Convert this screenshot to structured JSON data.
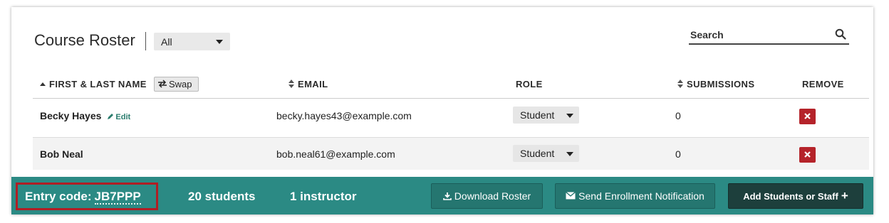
{
  "header": {
    "title": "Course Roster",
    "filter_value": "All",
    "search_placeholder": "Search"
  },
  "table": {
    "columns": {
      "name": "FIRST & LAST NAME",
      "swap": "Swap",
      "email": "EMAIL",
      "role": "ROLE",
      "submissions": "SUBMISSIONS",
      "remove": "REMOVE"
    },
    "rows": [
      {
        "name": "Becky Hayes",
        "edit": "Edit",
        "email": "becky.hayes43@example.com",
        "role": "Student",
        "submissions": "0"
      },
      {
        "name": "Bob Neal",
        "email": "bob.neal61@example.com",
        "role": "Student",
        "submissions": "0"
      }
    ]
  },
  "footer": {
    "entry_label": "Entry code:",
    "entry_code": "JB7PPP",
    "students": "20 students",
    "instructors": "1 instructor",
    "download_label": "Download Roster",
    "notify_label": "Send Enrollment Notification",
    "add_label": "Add Students or Staff",
    "add_plus": "+"
  },
  "icons": {
    "search": "search-icon",
    "swap": "swap-icon",
    "edit": "pencil-icon",
    "remove": "close-icon",
    "download": "download-icon",
    "notify": "envelope-icon"
  },
  "colors": {
    "footer_bg": "#2b8a84",
    "add_button_bg": "#1d3f3c",
    "remove_bg": "#b5232a",
    "highlight_border": "#b01e24",
    "edit_link": "#2a7d6e"
  }
}
